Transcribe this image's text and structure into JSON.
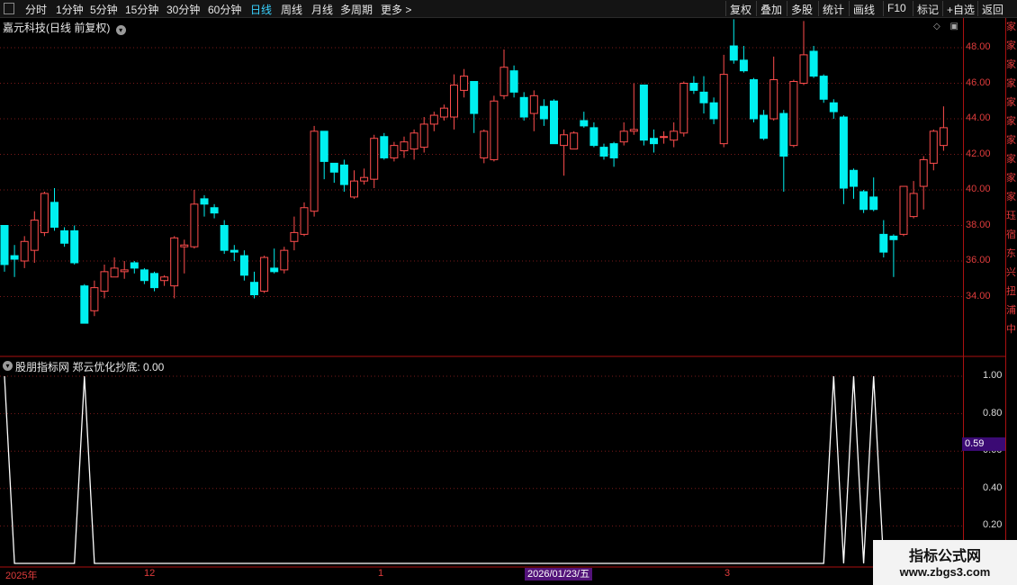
{
  "toolbar": {
    "left": [
      "分时",
      "1分钟",
      "5分钟",
      "15分钟",
      "30分钟",
      "60分钟",
      "日线",
      "周线",
      "月线",
      "多周期",
      "更多 >"
    ],
    "active": "日线",
    "right": [
      "复权",
      "叠加",
      "多股",
      "统计",
      "画线",
      "F10",
      "标记",
      "+自选",
      "返回"
    ]
  },
  "stock_title": "嘉元科技(日线 前复权)",
  "indicator_title": "股朋指标网 郑云优化抄底: 0.00",
  "price_axis": [
    "48.00",
    "46.00",
    "44.00",
    "42.00",
    "40.00",
    "38.00",
    "36.00",
    "34.00"
  ],
  "sub_axis": [
    "1.00",
    "0.80",
    "0.60",
    "0.40",
    "0.20"
  ],
  "value_tag": "0.59",
  "date_labels": [
    "2025年",
    "12",
    "1",
    "3"
  ],
  "date_tag": "2026/01/23/五",
  "right_strip_chars": [
    "家",
    "家",
    "家",
    "家",
    "家",
    "家",
    "家",
    "家",
    "家",
    "家",
    "珏",
    "宿",
    "东",
    "兴",
    "扭",
    "浦",
    "中"
  ],
  "watermark": {
    "line1": "指标公式网",
    "line2": "www.zbgs3.com"
  },
  "colors": {
    "up": "#ff4d4d",
    "down": "#00f0f0",
    "grid": "#7a1a1a",
    "line": "#ffffff"
  },
  "chart_data": {
    "type": "candlestick",
    "ylim": [
      32,
      50
    ],
    "candles": [
      [
        38.0,
        35.8,
        38.0,
        35.4
      ],
      [
        36.3,
        36.1,
        36.9,
        35.1
      ],
      [
        36.0,
        37.1,
        37.4,
        35.6
      ],
      [
        36.6,
        38.3,
        38.8,
        35.9
      ],
      [
        37.6,
        39.8,
        39.9,
        37.4
      ],
      [
        39.3,
        37.9,
        40.1,
        37.7
      ],
      [
        37.7,
        37.0,
        37.9,
        36.8
      ],
      [
        37.7,
        35.9,
        38.0,
        35.8
      ],
      [
        34.6,
        32.5,
        34.7,
        32.5
      ],
      [
        33.2,
        34.5,
        34.9,
        32.9
      ],
      [
        34.3,
        35.4,
        35.8,
        33.9
      ],
      [
        35.1,
        35.6,
        36.2,
        35.1
      ],
      [
        35.4,
        35.5,
        36.0,
        35.0
      ],
      [
        35.9,
        35.6,
        36.0,
        35.3
      ],
      [
        35.5,
        34.9,
        35.6,
        34.7
      ],
      [
        35.3,
        34.5,
        35.4,
        34.3
      ],
      [
        34.9,
        35.1,
        35.2,
        34.6
      ],
      [
        34.6,
        37.3,
        37.4,
        33.9
      ],
      [
        36.8,
        36.9,
        37.2,
        35.3
      ],
      [
        36.8,
        39.2,
        40.0,
        36.7
      ],
      [
        39.5,
        39.2,
        39.7,
        38.5
      ],
      [
        39.0,
        38.7,
        39.2,
        38.4
      ],
      [
        38.0,
        36.6,
        38.3,
        36.4
      ],
      [
        36.6,
        36.5,
        36.9,
        36.0
      ],
      [
        36.3,
        35.2,
        36.6,
        34.9
      ],
      [
        34.8,
        34.1,
        35.4,
        33.9
      ],
      [
        34.3,
        36.2,
        36.3,
        34.2
      ],
      [
        35.6,
        35.4,
        36.7,
        35.3
      ],
      [
        35.5,
        36.6,
        36.8,
        35.3
      ],
      [
        37.1,
        37.6,
        38.5,
        36.6
      ],
      [
        37.5,
        39.0,
        39.3,
        37.4
      ],
      [
        38.8,
        43.3,
        43.6,
        38.5
      ],
      [
        43.3,
        41.6,
        43.3,
        40.6
      ],
      [
        41.5,
        41.0,
        41.5,
        40.4
      ],
      [
        41.4,
        40.3,
        41.7,
        39.9
      ],
      [
        39.6,
        40.5,
        41.1,
        39.5
      ],
      [
        40.5,
        40.7,
        41.2,
        40.3
      ],
      [
        40.6,
        42.9,
        43.1,
        40.1
      ],
      [
        43.0,
        41.8,
        43.2,
        41.7
      ],
      [
        41.8,
        42.5,
        42.7,
        41.6
      ],
      [
        42.2,
        42.7,
        43.0,
        41.8
      ],
      [
        42.3,
        43.2,
        43.4,
        41.7
      ],
      [
        42.4,
        43.7,
        44.1,
        42.1
      ],
      [
        43.7,
        44.2,
        44.4,
        43.3
      ],
      [
        44.1,
        44.6,
        44.8,
        43.9
      ],
      [
        44.1,
        45.9,
        46.5,
        43.4
      ],
      [
        45.6,
        46.4,
        46.8,
        45.2
      ],
      [
        46.1,
        44.3,
        46.1,
        43.2
      ],
      [
        41.8,
        43.3,
        43.4,
        41.5
      ],
      [
        41.7,
        45.0,
        45.3,
        41.6
      ],
      [
        45.3,
        46.9,
        47.9,
        45.1
      ],
      [
        46.7,
        45.5,
        47.0,
        45.2
      ],
      [
        45.2,
        44.1,
        45.5,
        43.9
      ],
      [
        44.3,
        45.3,
        45.6,
        43.3
      ],
      [
        44.7,
        44.0,
        45.1,
        43.6
      ],
      [
        45.0,
        42.6,
        45.1,
        42.6
      ],
      [
        42.5,
        43.1,
        43.4,
        40.8
      ],
      [
        42.3,
        43.2,
        43.3,
        42.5
      ],
      [
        43.9,
        43.6,
        44.4,
        43.5
      ],
      [
        43.5,
        42.5,
        43.8,
        42.4
      ],
      [
        42.4,
        41.9,
        42.6,
        41.7
      ],
      [
        42.6,
        41.8,
        42.7,
        41.3
      ],
      [
        42.7,
        43.3,
        43.8,
        42.5
      ],
      [
        43.3,
        43.4,
        46.0,
        43.1
      ],
      [
        45.9,
        42.8,
        45.9,
        42.5
      ],
      [
        42.9,
        42.6,
        43.4,
        42.1
      ],
      [
        43.0,
        43.0,
        43.3,
        42.6
      ],
      [
        42.8,
        43.3,
        43.8,
        42.4
      ],
      [
        43.2,
        46.0,
        46.1,
        43.0
      ],
      [
        46.0,
        45.6,
        46.4,
        45.4
      ],
      [
        45.5,
        44.9,
        46.4,
        44.3
      ],
      [
        44.9,
        44.0,
        45.2,
        43.7
      ],
      [
        42.6,
        46.5,
        47.6,
        42.4
      ],
      [
        48.1,
        47.3,
        49.6,
        47.1
      ],
      [
        47.3,
        46.7,
        48.1,
        46.6
      ],
      [
        46.2,
        44.0,
        46.3,
        43.8
      ],
      [
        44.2,
        42.9,
        44.5,
        42.8
      ],
      [
        44.0,
        46.2,
        47.5,
        43.9
      ],
      [
        44.3,
        41.9,
        44.5,
        39.9
      ],
      [
        42.5,
        46.1,
        46.2,
        42.4
      ],
      [
        46.0,
        47.6,
        49.5,
        45.9
      ],
      [
        47.8,
        46.4,
        48.1,
        46.3
      ],
      [
        46.4,
        45.1,
        46.5,
        44.9
      ],
      [
        44.9,
        44.4,
        45.1,
        44.0
      ],
      [
        44.1,
        40.1,
        44.2,
        39.2
      ],
      [
        41.1,
        40.2,
        41.2,
        39.5
      ],
      [
        39.9,
        38.9,
        40.0,
        38.7
      ],
      [
        39.6,
        38.9,
        40.7,
        38.8
      ],
      [
        37.5,
        36.5,
        38.3,
        36.2
      ],
      [
        37.4,
        37.2,
        37.5,
        35.1
      ],
      [
        37.5,
        40.2,
        40.2,
        37.4
      ],
      [
        38.5,
        39.8,
        40.5,
        38.4
      ],
      [
        40.2,
        41.7,
        41.9,
        38.9
      ],
      [
        41.5,
        43.3,
        43.4,
        41.1
      ],
      [
        42.5,
        43.5,
        44.7,
        42.2
      ]
    ],
    "indicator": {
      "name": "郑云优化抄底",
      "values": [
        1,
        0,
        0,
        0,
        0,
        0,
        0,
        0,
        1,
        0,
        0,
        0,
        0,
        0,
        0,
        0,
        0,
        0,
        0,
        0,
        0,
        0,
        0,
        0,
        0,
        0,
        0,
        0,
        0,
        0,
        0,
        0,
        0,
        0,
        0,
        0,
        0,
        0,
        0,
        0,
        0,
        0,
        0,
        0,
        0,
        0,
        0,
        0,
        0,
        0,
        0,
        0,
        0,
        0,
        0,
        0,
        0,
        0,
        0,
        0,
        0,
        0,
        0,
        0,
        0,
        0,
        0,
        0,
        0,
        0,
        0,
        0,
        0,
        0,
        0,
        0,
        0,
        0,
        0,
        0,
        0,
        0,
        0,
        1,
        0,
        1,
        0,
        1,
        0,
        0,
        0,
        0,
        0,
        0,
        0
      ],
      "ylim": [
        -0.05,
        1.05
      ]
    }
  }
}
